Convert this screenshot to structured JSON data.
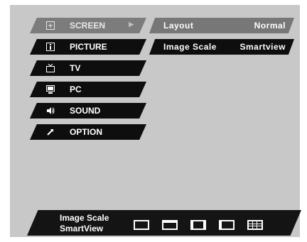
{
  "menu": {
    "items": [
      {
        "label": "SCREEN",
        "icon": "screen-icon",
        "glyph": "⊞",
        "arrow": "▶"
      },
      {
        "label": "PICTURE",
        "icon": "picture-icon",
        "glyph": "▣"
      },
      {
        "label": "TV",
        "icon": "tv-icon",
        "glyph": "📺"
      },
      {
        "label": "PC",
        "icon": "pc-icon",
        "glyph": "▤"
      },
      {
        "label": "SOUND",
        "icon": "sound-icon",
        "glyph": "🔊"
      },
      {
        "label": "OPTION",
        "icon": "option-icon",
        "glyph": "↗"
      }
    ]
  },
  "settings": {
    "rows": [
      {
        "name": "Layout",
        "value": "Normal"
      },
      {
        "name": "Image Scale",
        "value": "Smartview"
      }
    ]
  },
  "bottom_bar": {
    "line1": "Image Scale",
    "line2": "SmartView"
  },
  "colors": {
    "panel": "#c8c8c8",
    "item_bg": "#0e0e0e",
    "selected_bg": "#7c7c7c",
    "text": "#ffffff"
  }
}
